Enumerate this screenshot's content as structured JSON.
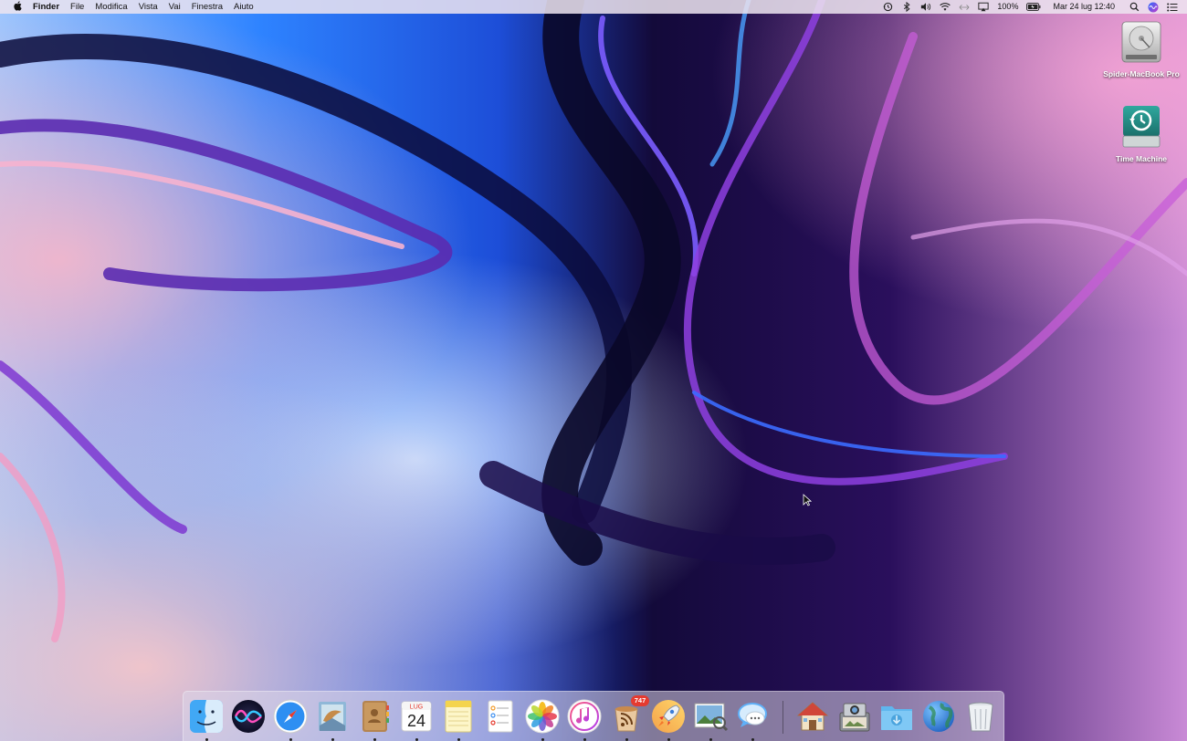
{
  "menubar": {
    "apple_icon": "apple-icon",
    "app_name": "Finder",
    "menus": [
      "File",
      "Modifica",
      "Vista",
      "Vai",
      "Finestra",
      "Aiuto"
    ],
    "status_icons": [
      "time-machine-icon",
      "bluetooth-icon",
      "volume-icon",
      "wifi-icon",
      "sync-arrows-icon",
      "airplay-icon"
    ],
    "battery_percent": "100%",
    "datetime": "Mar 24 lug  12:40",
    "right_icons": [
      "spotlight-search-icon",
      "siri-icon",
      "notification-center-icon"
    ]
  },
  "desktop_icons": [
    {
      "label": "Spider-MacBook Pro",
      "icon": "hard-drive-icon"
    },
    {
      "label": "Time Machine",
      "icon": "time-machine-drive-icon"
    }
  ],
  "dock": {
    "apps": [
      {
        "name": "Finder",
        "icon": "finder-icon",
        "running": true
      },
      {
        "name": "Siri",
        "icon": "siri-icon",
        "running": false
      },
      {
        "name": "Safari",
        "icon": "safari-icon",
        "running": true
      },
      {
        "name": "Mail",
        "icon": "mail-icon",
        "running": true
      },
      {
        "name": "Contatti",
        "icon": "contacts-icon",
        "running": true
      },
      {
        "name": "Calendario",
        "icon": "calendar-icon",
        "running": true,
        "month": "LUG",
        "day": "24"
      },
      {
        "name": "Note",
        "icon": "notes-icon",
        "running": true
      },
      {
        "name": "Promemoria",
        "icon": "reminders-icon",
        "running": false
      },
      {
        "name": "Foto",
        "icon": "photos-icon",
        "running": true
      },
      {
        "name": "iTunes",
        "icon": "itunes-icon",
        "running": true
      },
      {
        "name": "Feed Reader",
        "icon": "rss-reader-icon",
        "running": true,
        "badge": "747"
      },
      {
        "name": "Launchpad",
        "icon": "rocket-icon",
        "running": true
      },
      {
        "name": "Anteprima",
        "icon": "preview-icon",
        "running": true
      },
      {
        "name": "Messaggi",
        "icon": "messages-icon",
        "running": true
      }
    ],
    "stack": [
      {
        "name": "Inizio",
        "icon": "home-folder-icon"
      },
      {
        "name": "Acquisizione Immagine",
        "icon": "image-capture-icon"
      },
      {
        "name": "Download",
        "icon": "downloads-folder-icon"
      },
      {
        "name": "Rete",
        "icon": "globe-icon"
      },
      {
        "name": "Cestino",
        "icon": "trash-icon"
      }
    ]
  },
  "colors": {
    "menubar_bg": "#ece4f0",
    "wallpaper_blue": "#2f7fff",
    "wallpaper_purple": "#6a2fb8",
    "wallpaper_pink": "#f2b3c8",
    "badge_red": "#e53b30"
  }
}
